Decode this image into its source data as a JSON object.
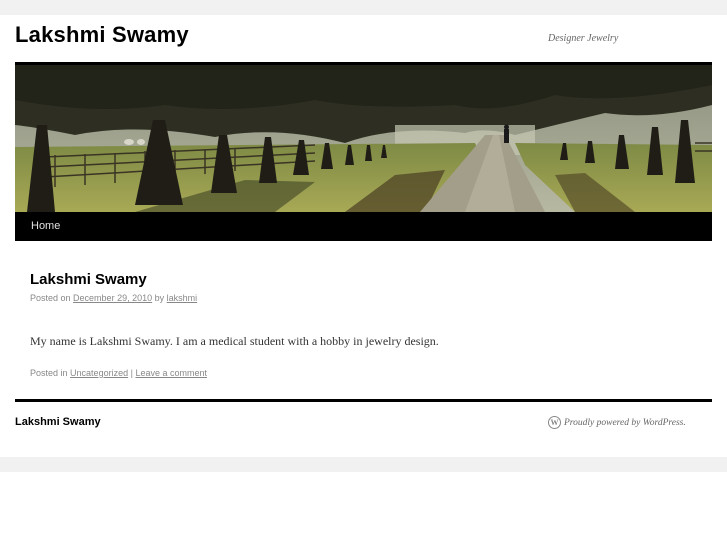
{
  "site": {
    "title": "Lakshmi Swamy",
    "description": "Designer Jewelry"
  },
  "header": {
    "banner_image": "tree-lined country road with path and fence"
  },
  "nav": {
    "items": [
      {
        "label": "Home"
      }
    ]
  },
  "post": {
    "title": "Lakshmi Swamy",
    "posted_on_label": "Posted on",
    "date": "December 29, 2010",
    "by_label": "by",
    "author": "lakshmi",
    "content": "My name is Lakshmi Swamy.  I am a medical student with a hobby in jewelry design.",
    "posted_in_label": "Posted in",
    "category": "Uncategorized",
    "separator": "|",
    "comment_link": "Leave a comment"
  },
  "footer": {
    "site_title": "Lakshmi Swamy",
    "credit": "Proudly powered by WordPress."
  },
  "colors": {
    "nav_background": "#000000",
    "page_band": "#f1f1f1",
    "meta_text": "#888888"
  }
}
